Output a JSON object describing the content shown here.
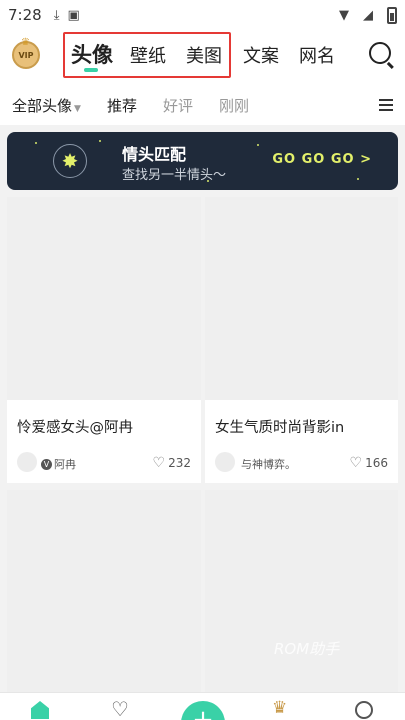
{
  "status_bar": {
    "time": "7:28",
    "icons": [
      "download-icon",
      "a-icon",
      "wifi-icon",
      "signal-icon",
      "battery-icon"
    ]
  },
  "header": {
    "vip_label": "VIP",
    "tabs": [
      {
        "label": "头像",
        "active": true
      },
      {
        "label": "壁纸",
        "active": false
      },
      {
        "label": "美图",
        "active": false
      },
      {
        "label": "文案",
        "active": false
      },
      {
        "label": "网名",
        "active": false
      }
    ],
    "accent": "#3ad1a7",
    "highlight_color": "#e53935"
  },
  "filters": {
    "items": [
      {
        "label": "全部头像",
        "dim": false
      },
      {
        "label": "推荐",
        "dim": false
      },
      {
        "label": "好评",
        "dim": true
      },
      {
        "label": "刚刚",
        "dim": true
      }
    ]
  },
  "banner": {
    "title": "情头匹配",
    "subtitle": "查找另一半情头～",
    "cta": "GO GO GO >"
  },
  "cards": [
    {
      "title": "怜爱感女头@阿冉",
      "author": "阿冉",
      "verified": true,
      "likes": "232"
    },
    {
      "title": "女生气质时尚背影in",
      "author": "与神博弈。",
      "verified": false,
      "likes": "166"
    },
    {
      "title": "",
      "author": "",
      "verified": false,
      "likes": ""
    },
    {
      "title": "",
      "author": "",
      "verified": false,
      "likes": ""
    }
  ],
  "watermark": "ROM助手",
  "bottom_nav": {
    "add_label": "+"
  }
}
